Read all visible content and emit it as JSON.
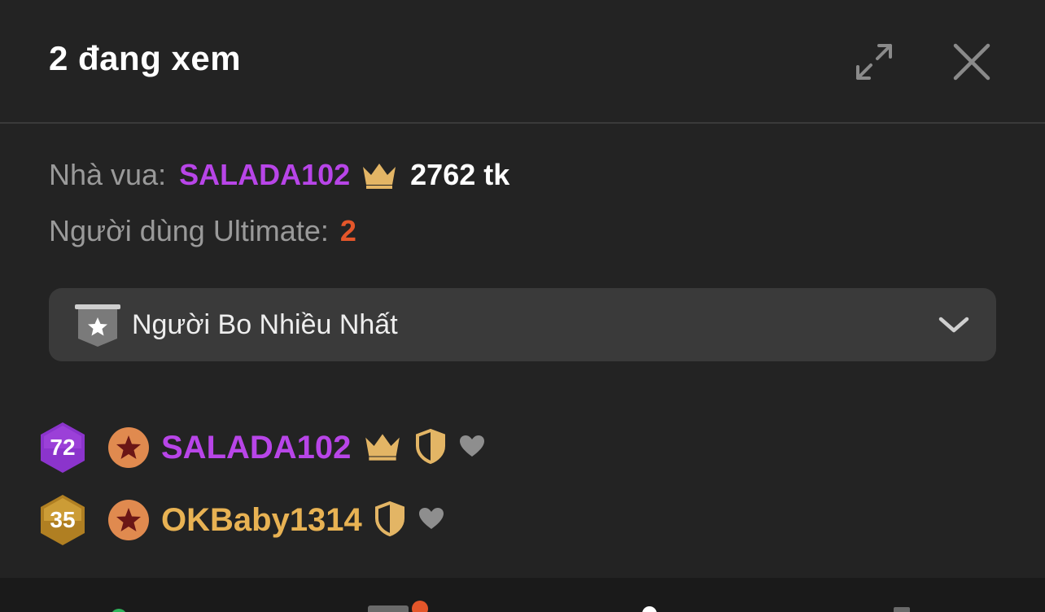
{
  "header": {
    "title": "2 đang xem"
  },
  "king": {
    "label": "Nhà vua:",
    "name": "SALADA102",
    "tokens": "2762 tk"
  },
  "ultimate": {
    "label": "Người dùng Ultimate:",
    "count": "2"
  },
  "dropdown": {
    "label": "Người Bo Nhiều Nhất"
  },
  "users": [
    {
      "level": "72",
      "name": "SALADA102",
      "badge_color": "#9b3fd9",
      "name_color": "#b845e8"
    },
    {
      "level": "35",
      "name": "OKBaby1314",
      "badge_color": "#c8962e",
      "name_color": "#e8b253"
    }
  ],
  "colors": {
    "background": "#232323",
    "king_purple": "#b845e8",
    "ultimate_orange": "#e4562a",
    "crown_gold": "#e3b565",
    "dropdown_bg": "#3a3a3a"
  }
}
